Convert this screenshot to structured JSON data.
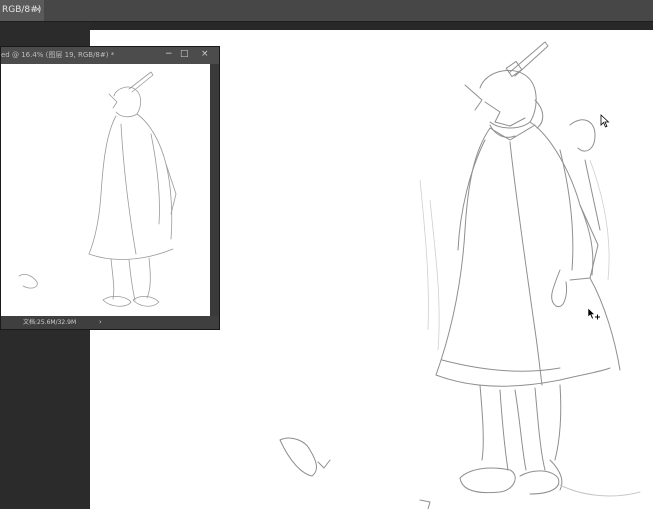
{
  "tabbar": {
    "active_tab_label": "RGB/8#) *",
    "close_glyph": "×"
  },
  "nav_window": {
    "title": "ed @ 16.4% (图层 19, RGB/8#) *",
    "minimize_glyph": "−",
    "maximize_glyph": "□",
    "close_glyph": "×",
    "status_text": "文档:25.6M/32.9M",
    "status_arrow": "›"
  },
  "canvas": {
    "background": "#ffffff",
    "sketch_color": "#9a9a9a"
  },
  "cursors": {
    "arrow_cursor": "arrow-pointer-icon",
    "move_cursor": "move-arrow-icon"
  }
}
